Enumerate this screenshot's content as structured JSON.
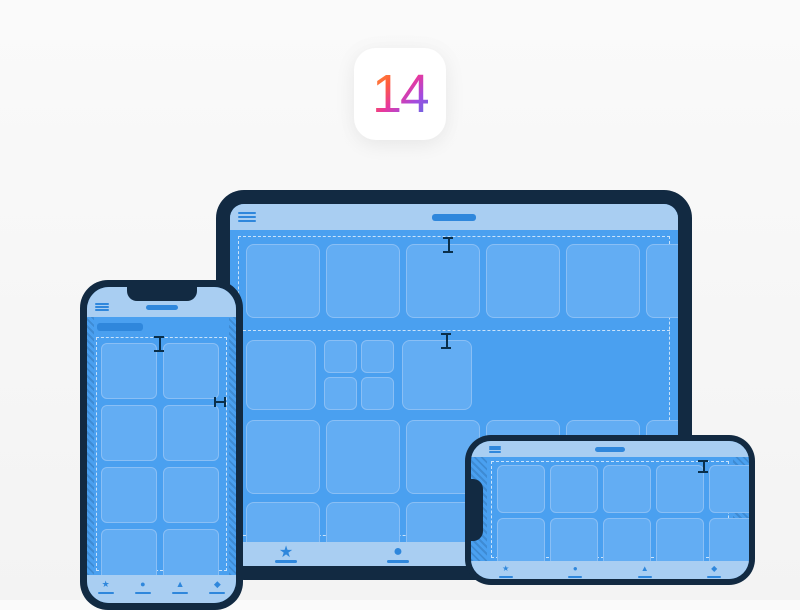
{
  "ios_version": "14",
  "colors": {
    "device_frame": "#122a42",
    "screen_bg": "#4aa0f0",
    "nav_bg": "#a9cef2",
    "accent": "#2f87dc",
    "tile_fill": "#63adf3",
    "tile_border": "#8abff5",
    "guide": "rgba(255,255,255,0.7)"
  },
  "devices": [
    {
      "type": "ipad",
      "orientation": "landscape"
    },
    {
      "type": "iphone",
      "orientation": "portrait"
    },
    {
      "type": "iphone",
      "orientation": "landscape"
    }
  ],
  "tab_icons": [
    "star",
    "circle",
    "triangle",
    "diamond"
  ]
}
